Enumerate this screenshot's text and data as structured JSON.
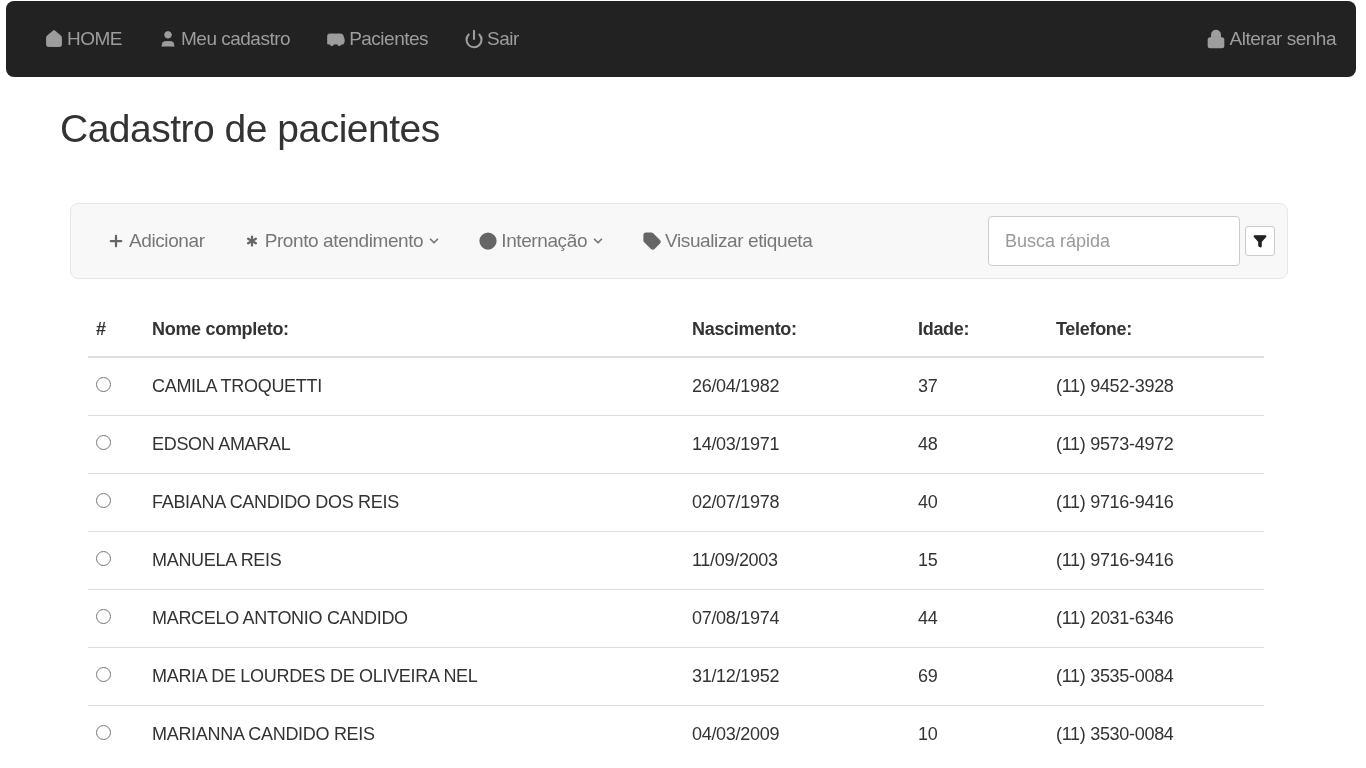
{
  "navbar": {
    "left": [
      {
        "label": "HOME"
      },
      {
        "label": "Meu cadastro"
      },
      {
        "label": "Pacientes"
      },
      {
        "label": "Sair"
      }
    ],
    "right": [
      {
        "label": "Alterar senha"
      }
    ]
  },
  "title": "Cadastro de pacientes",
  "toolbar": {
    "actions": [
      {
        "label": "Adicionar",
        "dropdown": false
      },
      {
        "label": "Pronto atendimento",
        "dropdown": true
      },
      {
        "label": "Internação",
        "dropdown": true
      },
      {
        "label": "Visualizar etiqueta",
        "dropdown": false
      }
    ],
    "search": {
      "placeholder": "Busca rápida"
    }
  },
  "table": {
    "select_header": "#",
    "columns": [
      "Nome completo:",
      "Nascimento:",
      "Idade:",
      "Telefone:"
    ],
    "rows": [
      {
        "selected": false,
        "cells": [
          "CAMILA TROQUETTI",
          "26/04/1982",
          "37",
          "(11) 9452-3928"
        ]
      },
      {
        "selected": false,
        "cells": [
          "EDSON AMARAL",
          "14/03/1971",
          "48",
          "(11) 9573-4972"
        ]
      },
      {
        "selected": false,
        "cells": [
          "FABIANA CANDIDO DOS REIS",
          "02/07/1978",
          "40",
          "(11) 9716-9416"
        ]
      },
      {
        "selected": false,
        "cells": [
          "MANUELA REIS",
          "11/09/2003",
          "15",
          "(11) 9716-9416"
        ]
      },
      {
        "selected": false,
        "cells": [
          "MARCELO ANTONIO CANDIDO",
          "07/08/1974",
          "44",
          "(11) 2031-6346"
        ]
      },
      {
        "selected": false,
        "cells": [
          "MARIA DE LOURDES DE OLIVEIRA NEL",
          "31/12/1952",
          "69",
          "(11) 3535-0084"
        ]
      },
      {
        "selected": false,
        "cells": [
          "MARIANNA CANDIDO REIS",
          "04/03/2009",
          "10",
          "(11) 3530-0084"
        ]
      }
    ]
  }
}
